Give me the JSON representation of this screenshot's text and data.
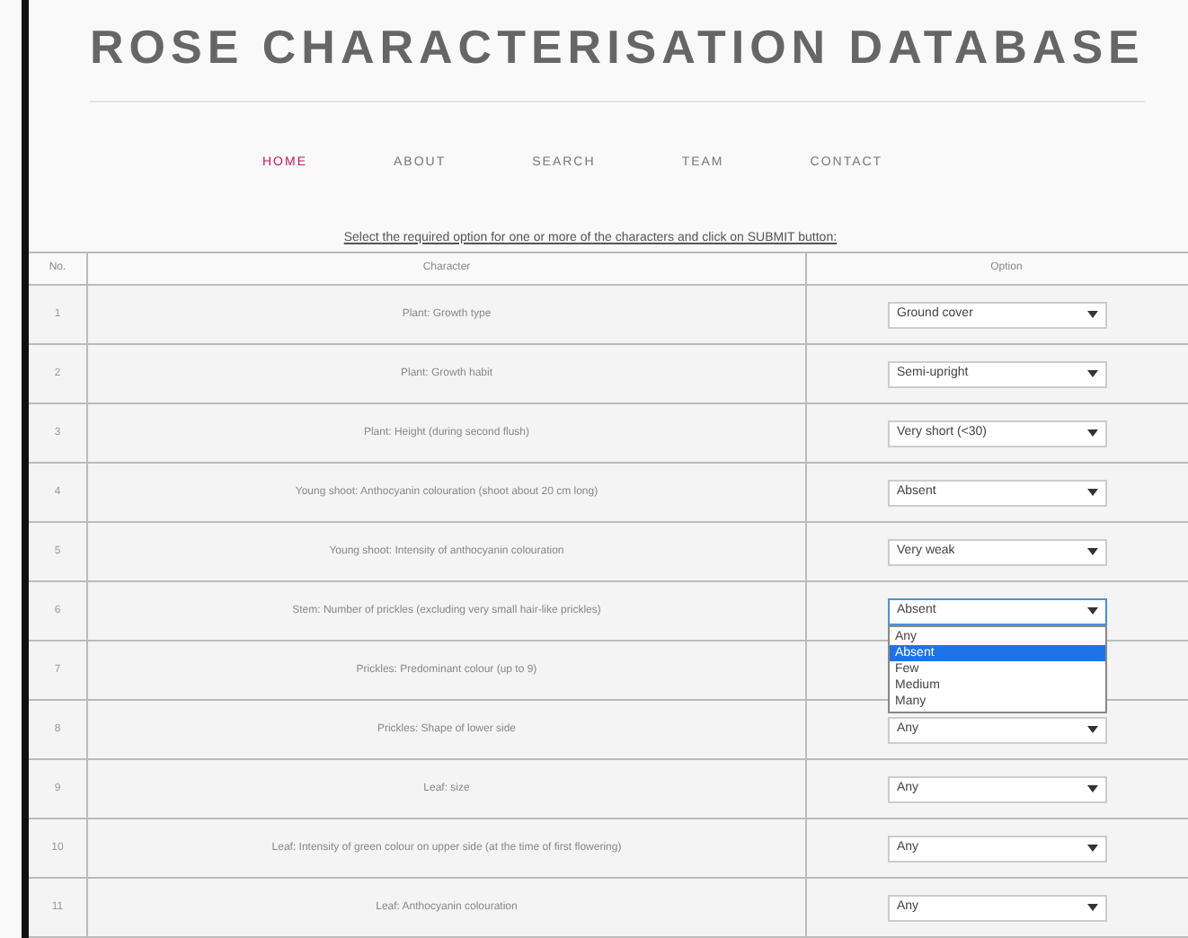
{
  "title": "ROSE CHARACTERISATION DATABASE",
  "nav": [
    {
      "label": "HOME",
      "selected": true
    },
    {
      "label": "ABOUT",
      "selected": false
    },
    {
      "label": "SEARCH",
      "selected": false
    },
    {
      "label": "TEAM",
      "selected": false
    },
    {
      "label": "CONTACT",
      "selected": false
    }
  ],
  "instruction": "Select the required option for one or more of the characters and click on SUBMIT button:",
  "table": {
    "columns": [
      "No.",
      "Character",
      "Option"
    ],
    "rows": [
      {
        "no": "1",
        "character": "Plant: Growth type",
        "value": "Ground cover"
      },
      {
        "no": "2",
        "character": "Plant: Growth habit",
        "value": "Semi-upright"
      },
      {
        "no": "3",
        "character": "Plant: Height (during second flush)",
        "value": "Very short (<30)"
      },
      {
        "no": "4",
        "character": "Young shoot: Anthocyanin colouration (shoot about 20 cm long)",
        "value": "Absent"
      },
      {
        "no": "5",
        "character": "Young shoot: Intensity of anthocyanin colouration",
        "value": "Very weak"
      },
      {
        "no": "6",
        "character": "Stem: Number of prickles (excluding very small hair-like prickles)",
        "value": "Absent",
        "options": [
          {
            "label": "Any",
            "selected": false
          },
          {
            "label": "Absent",
            "selected": true
          },
          {
            "label": "Few",
            "selected": false
          },
          {
            "label": "Medium",
            "selected": false
          },
          {
            "label": "Many",
            "selected": false
          }
        ]
      },
      {
        "no": "7",
        "character": "Prickles: Predominant colour (up to 9)"
      },
      {
        "no": "8",
        "character": "Prickles: Shape of lower side",
        "value": "Any"
      },
      {
        "no": "9",
        "character": "Leaf: size",
        "value": "Any"
      },
      {
        "no": "10",
        "character": "Leaf: Intensity of green colour on upper side (at the time of first flowering)",
        "value": "Any"
      },
      {
        "no": "11",
        "character": "Leaf: Anthocyanin colouration",
        "value": "Any"
      }
    ]
  }
}
